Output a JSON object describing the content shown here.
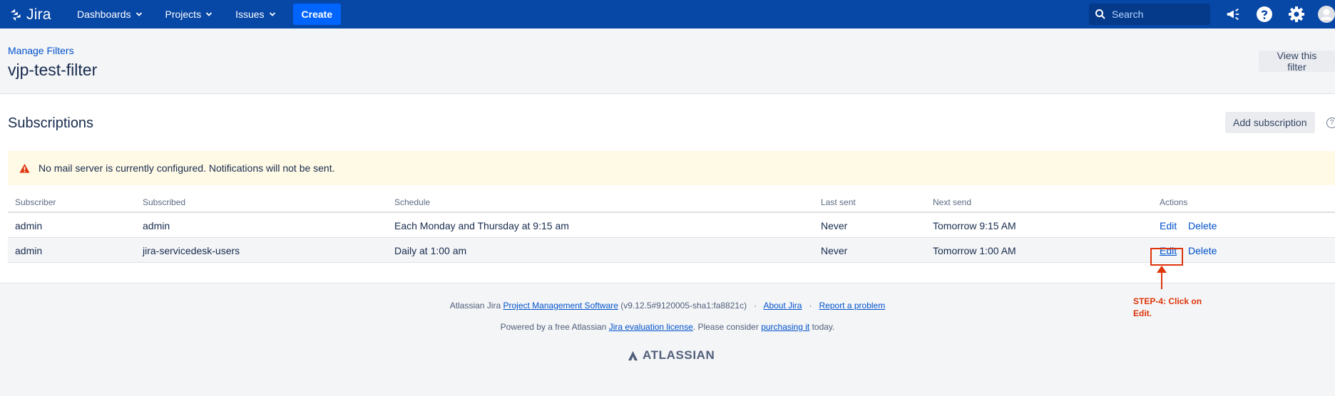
{
  "header": {
    "logo_text": "Jira",
    "nav": {
      "dashboards": "Dashboards",
      "projects": "Projects",
      "issues": "Issues",
      "create": "Create"
    },
    "search_placeholder": "Search",
    "icons": [
      "announcement-icon",
      "help-icon",
      "gear-icon",
      "avatar"
    ]
  },
  "page": {
    "breadcrumb": "Manage Filters",
    "title": "vjp-test-filter",
    "view_button": "View this filter"
  },
  "subscriptions": {
    "title": "Subscriptions",
    "add_button": "Add subscription",
    "help_glyph": "?",
    "warning": "No mail server is currently configured. Notifications will not be sent.",
    "columns": {
      "subscriber": "Subscriber",
      "subscribed": "Subscribed",
      "schedule": "Schedule",
      "last_sent": "Last sent",
      "next_send": "Next send",
      "actions": "Actions"
    },
    "rows": [
      {
        "subscriber": "admin",
        "subscribed": "admin",
        "schedule": "Each Monday and Thursday at 9:15 am",
        "last_sent": "Never",
        "next_send": "Tomorrow 9:15 AM",
        "edit": "Edit",
        "delete": "Delete"
      },
      {
        "subscriber": "admin",
        "subscribed": "jira-servicedesk-users",
        "schedule": "Daily at 1:00 am",
        "last_sent": "Never",
        "next_send": "Tomorrow 1:00 AM",
        "edit": "Edit",
        "delete": "Delete"
      }
    ]
  },
  "annotation": {
    "text_line1": "STEP-4: Click on",
    "text_line2": "Edit.",
    "color": "#de350b"
  },
  "footer": {
    "line1_prefix": "Atlassian Jira",
    "line1_link1": "Project Management Software",
    "line1_version": "(v9.12.5#9120005-sha1:fa8821c)",
    "sep": "·",
    "line1_link2": "About Jira",
    "line1_link3": "Report a problem",
    "line2_prefix": "Powered by a free Atlassian",
    "line2_link1": "Jira evaluation license",
    "line2_mid": ". Please consider",
    "line2_link2": "purchasing it",
    "line2_suffix": "today.",
    "logo_text": "ATLASSIAN"
  },
  "colors": {
    "header_bg": "#0747a6",
    "create_btn": "#0065ff",
    "link": "#0052cc",
    "warning_bg": "#fffae6",
    "warning_icon": "#de350b"
  }
}
